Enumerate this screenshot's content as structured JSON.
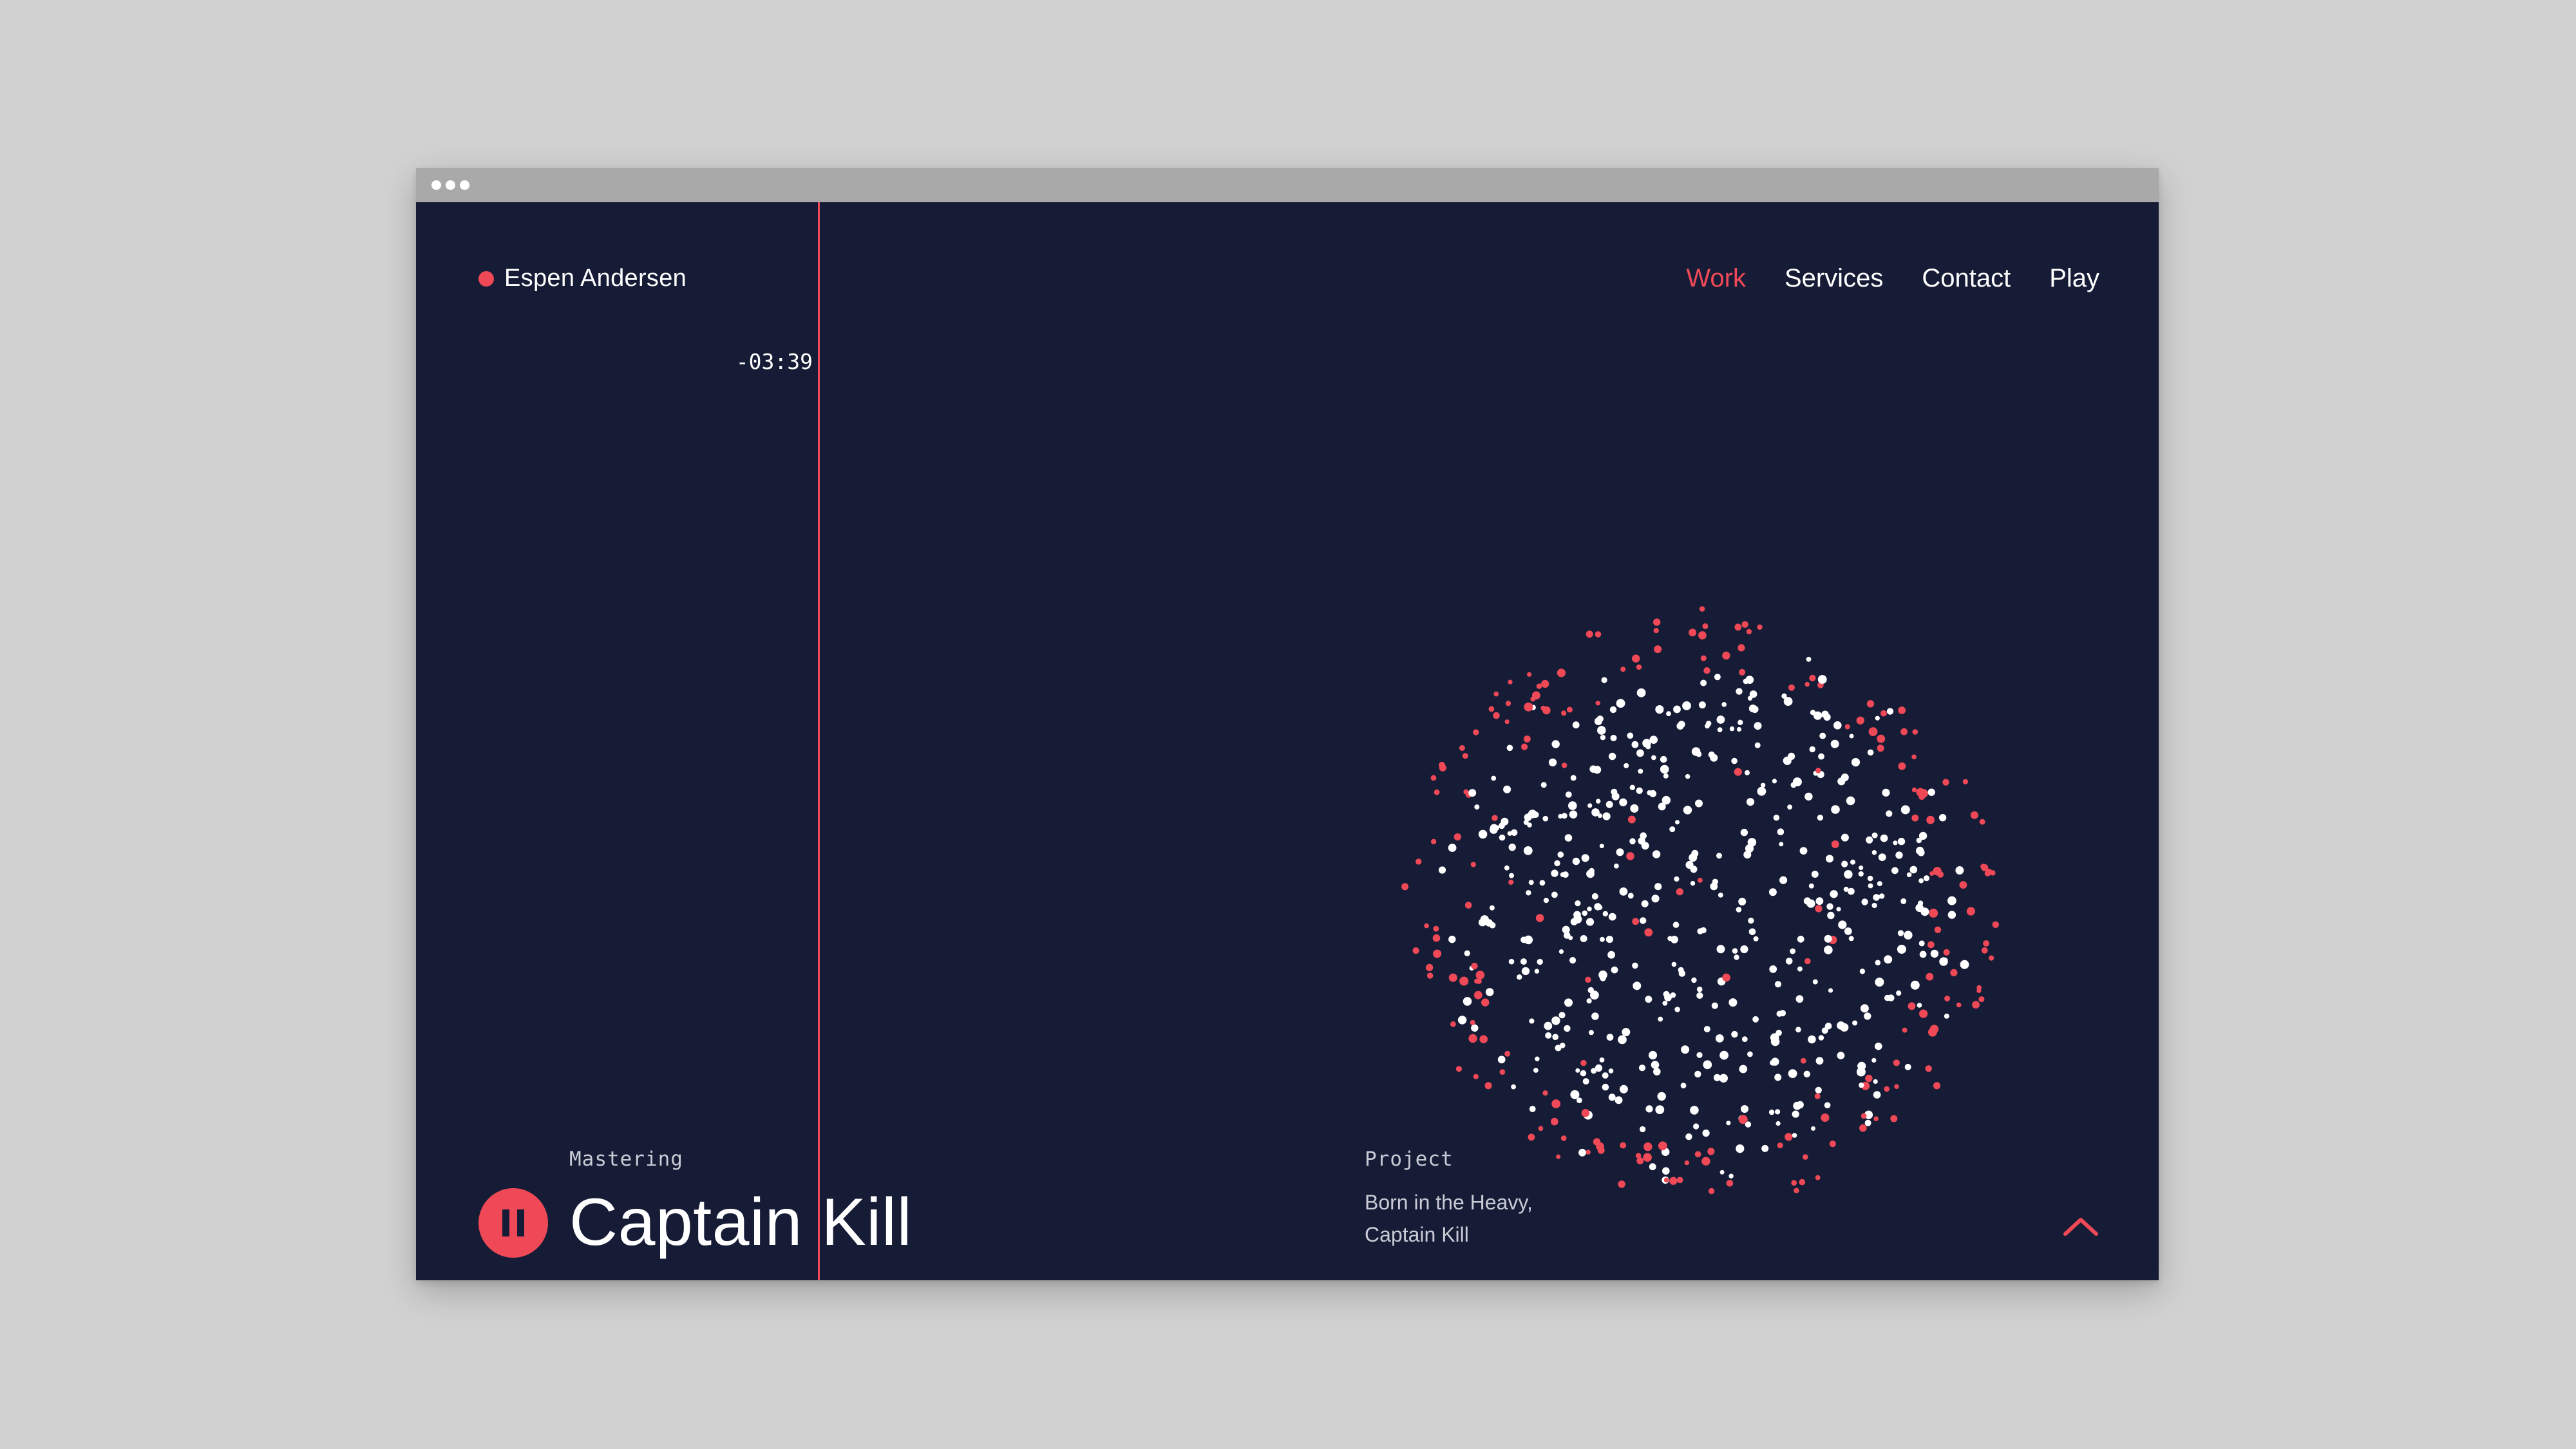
{
  "site": {
    "brand_name": "Espen Andersen",
    "accent_color": "#ef4957",
    "background_color": "#171c36"
  },
  "nav": {
    "items": [
      {
        "label": "Work",
        "active": true
      },
      {
        "label": "Services",
        "active": false
      },
      {
        "label": "Contact",
        "active": false
      },
      {
        "label": "Play",
        "active": false
      }
    ]
  },
  "player": {
    "time_remaining": "-03:39",
    "category": "Mastering",
    "track_title": "Captain Kill",
    "pause_icon": "pause-icon",
    "project_label": "Project",
    "project_line1": "Born in the Heavy,",
    "project_line2": "Captain Kill"
  },
  "footer": {
    "scroll_up_icon": "chevron-up-icon"
  },
  "visualizer": {
    "dot_colors": [
      "#ffffff",
      "#ef4957"
    ]
  }
}
